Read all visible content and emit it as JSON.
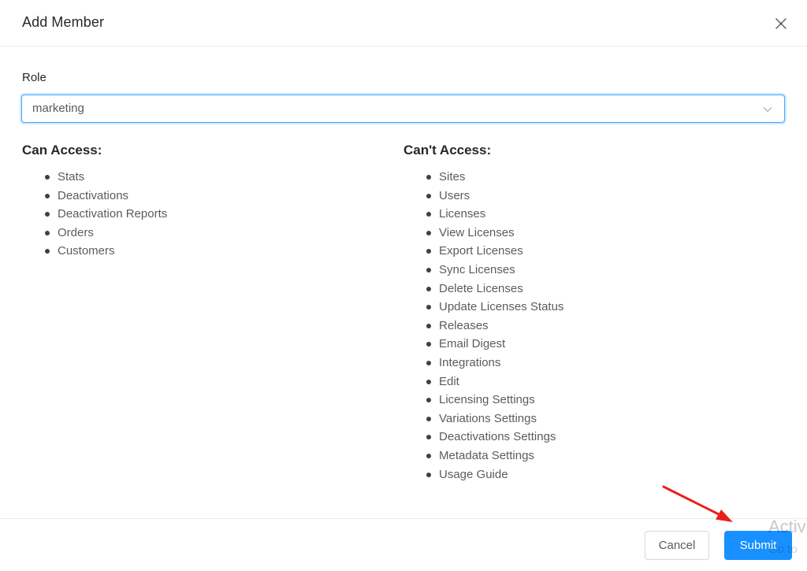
{
  "modal": {
    "title": "Add Member",
    "close_icon": "close-icon"
  },
  "role_field": {
    "label": "Role",
    "value": "marketing",
    "arrow_icon": "chevron-down-icon"
  },
  "can_access": {
    "title": "Can Access:",
    "items": [
      "Stats",
      "Deactivations",
      "Deactivation Reports",
      "Orders",
      "Customers"
    ]
  },
  "cant_access": {
    "title": "Can't Access:",
    "items": [
      "Sites",
      "Users",
      "Licenses",
      "View Licenses",
      "Export Licenses",
      "Sync Licenses",
      "Delete Licenses",
      "Update Licenses Status",
      "Releases",
      "Email Digest",
      "Integrations",
      "Edit",
      "Licensing Settings",
      "Variations Settings",
      "Deactivations Settings",
      "Metadata Settings",
      "Usage Guide"
    ]
  },
  "footer": {
    "cancel_label": "Cancel",
    "submit_label": "Submit"
  },
  "overlay": {
    "watermark_line1": "Activ",
    "watermark_line2": "Go to",
    "annotation_icon": "red-arrow-icon"
  },
  "colors": {
    "primary": "#1890ff",
    "focus_border": "#40a9ff",
    "annotation": "#e8201c"
  }
}
